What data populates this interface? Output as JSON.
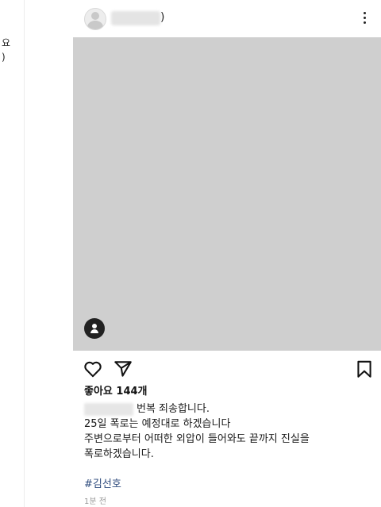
{
  "left_edge": {
    "line1": "요",
    "line2": ")"
  },
  "post": {
    "username_tail": ")",
    "likes_text": "좋아요 144개",
    "caption": {
      "line1": "번복 죄송합니다.",
      "line2": "25일 폭로는 예정대로 하겠습니다",
      "line3": "주변으로부터 어떠한 외압이 들어와도 끝까지 진실을",
      "line4": "폭로하겠습니다."
    },
    "hashtag": "#김선호",
    "timestamp": "1분 전",
    "icons": {
      "avatar": "default-avatar-icon",
      "more": "more-vertical-icon",
      "tag": "user-tag-icon",
      "like": "heart-icon",
      "share": "send-icon",
      "save": "bookmark-icon"
    }
  }
}
